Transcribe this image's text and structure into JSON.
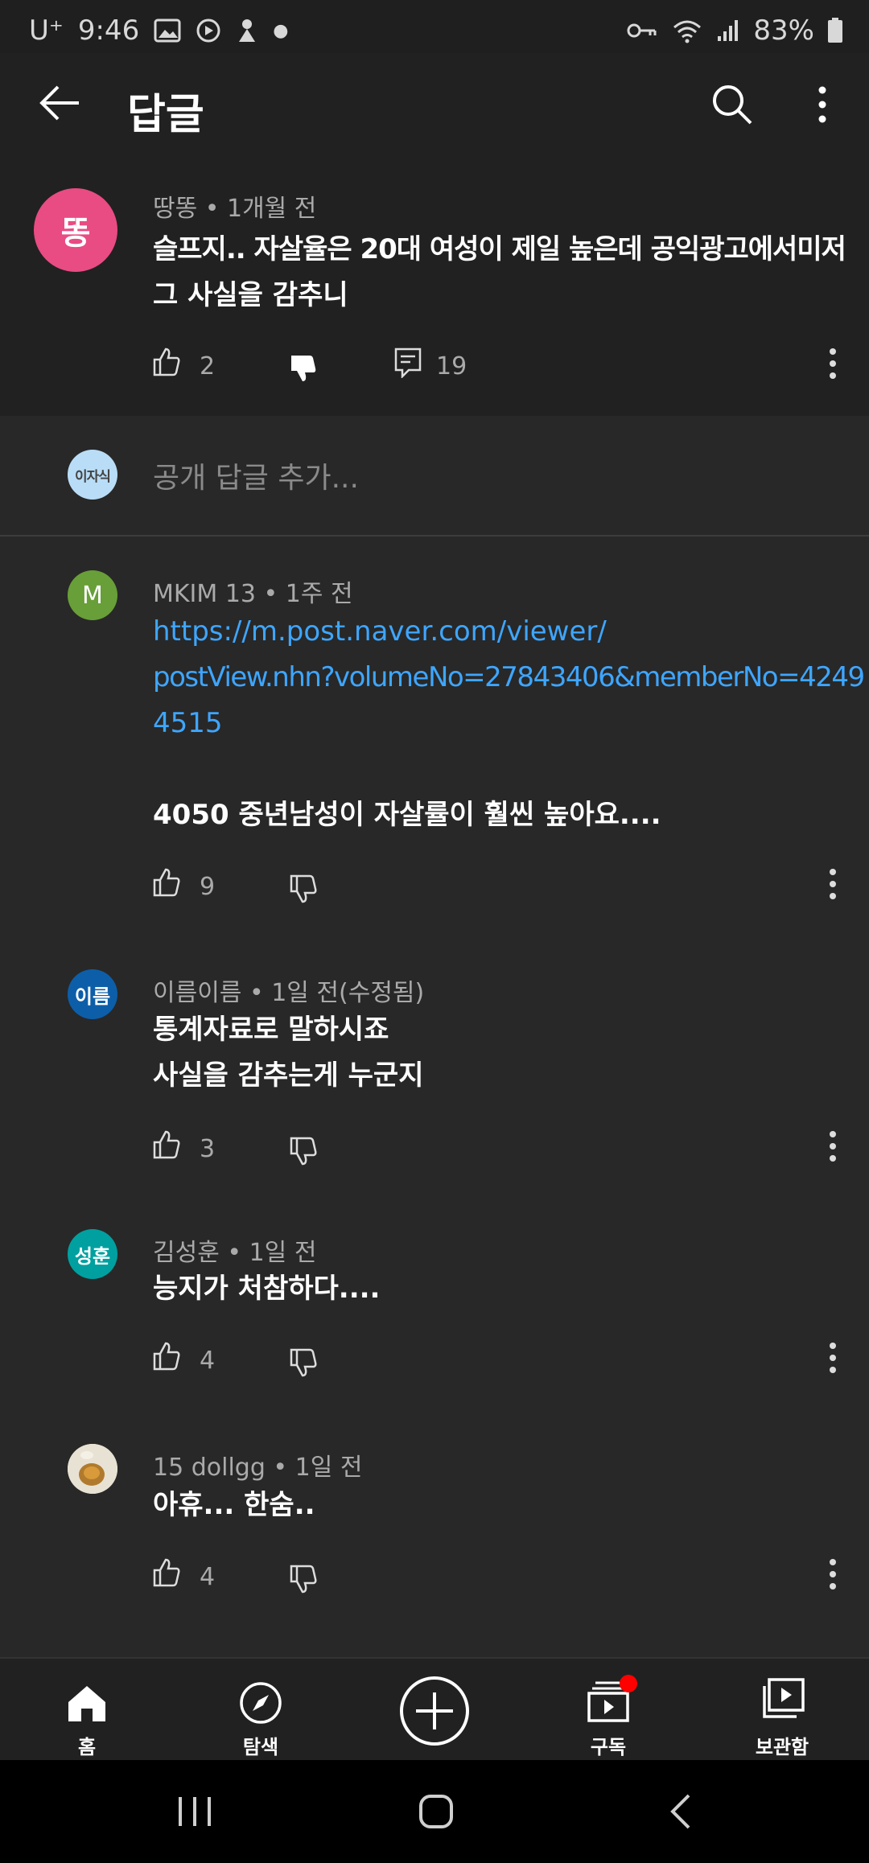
{
  "status_bar": {
    "carrier": "U⁺",
    "time": "9:46",
    "battery": "83%"
  },
  "app_bar": {
    "title": "답글"
  },
  "parent_comment": {
    "avatar_text": "똥",
    "avatar_color": "#e94b83",
    "author": "땅똥",
    "time": "1개월 전",
    "lines": [
      "슬프지.. 자살율은 20대 여성이 제일 높은데 공익광고에서미저",
      "그 사실을 감추니"
    ],
    "likes": "2",
    "replies": "19"
  },
  "reply_input": {
    "avatar_text": "이자식",
    "placeholder": "공개 답글 추가..."
  },
  "replies": [
    {
      "avatar_text": "M",
      "avatar_color": "#689f38",
      "author": "MKIM 13",
      "time": "1주 전",
      "link_lines": [
        "https://m.post.naver.com/viewer/",
        "postView.nhn?volumeNo=27843406&memberNo=4249",
        "4515"
      ],
      "text_lines": [
        "4050 중년남성이 자살률이 훨씬 높아요...."
      ],
      "likes": "9"
    },
    {
      "avatar_text": "이름",
      "avatar_color": "#0d5ea8",
      "author": "이름이름",
      "time": "1일 전(수정됨)",
      "text_lines": [
        "통계자료로 말하시죠",
        "사실을 감추는게 누군지"
      ],
      "likes": "3"
    },
    {
      "avatar_text": "성훈",
      "avatar_color": "#00a0a0",
      "author": "김성훈",
      "time": "1일 전",
      "text_lines": [
        "능지가 처참하다...."
      ],
      "likes": "4"
    },
    {
      "avatar_text": "",
      "avatar_color": "#c9b58e",
      "author": "15 dollgg",
      "time": "1일 전",
      "text_lines": [
        "아휴... 한숨.."
      ],
      "likes": "4"
    }
  ],
  "bottom_nav": {
    "home": "홈",
    "explore": "탐색",
    "subscriptions": "구독",
    "library": "보관함"
  }
}
